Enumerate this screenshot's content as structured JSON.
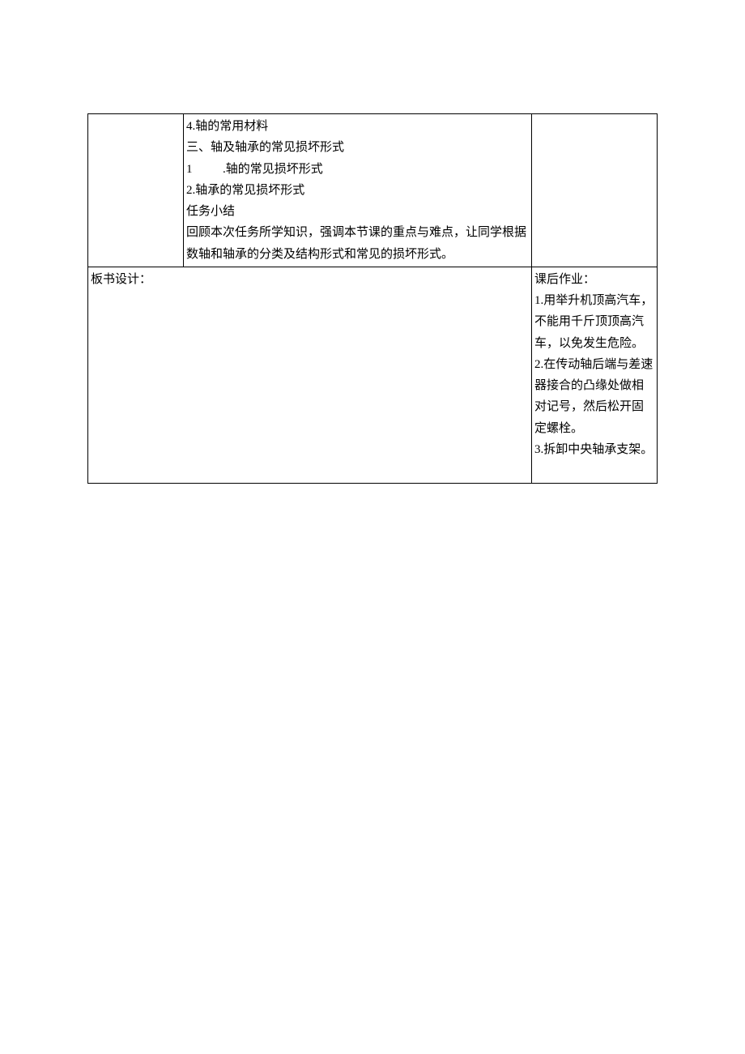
{
  "row1": {
    "col1": "",
    "col2_lines": [
      "4.轴的常用材料",
      "三、轴及轴承的常见损坏形式",
      "1          .轴的常见损坏形式",
      "2.轴承的常见损坏形式",
      "任务小结",
      "回顾本次任务所学知识，强调本节课的重点与难点，让同学根据数轴和轴承的分类及结构形式和常见的损坏形式。"
    ],
    "col3": ""
  },
  "row2": {
    "left_label": "板书设计：",
    "right_label": "课后作业：",
    "right_items": [
      "1.用举升机顶高汽车，不能用千斤顶顶高汽车，以免发生危险。",
      "2.在传动轴后端与差速器接合的凸缘处做相对记号，然后松开固定螺栓。",
      "3.拆卸中央轴承支架。"
    ]
  }
}
